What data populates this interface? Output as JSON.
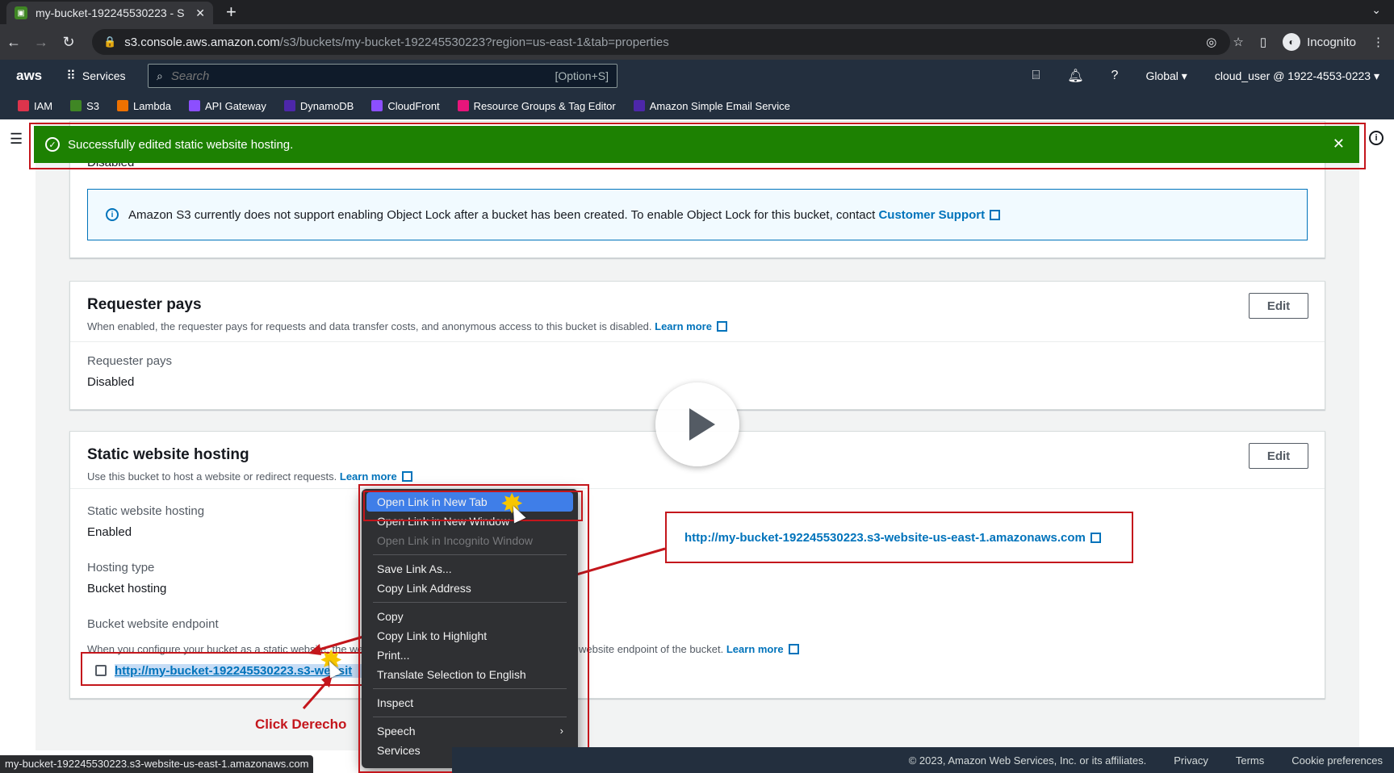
{
  "browser": {
    "tab_title": "my-bucket-192245530223 - S",
    "url_host": "s3.console.aws.amazon.com",
    "url_path": "/s3/buckets/my-bucket-192245530223?region=us-east-1&tab=properties",
    "profile_label": "Incognito"
  },
  "aws_header": {
    "logo": "aws",
    "services_label": "Services",
    "search_placeholder": "Search",
    "search_hint": "[Option+S]",
    "region": "Global",
    "account": "cloud_user @ 1922-4553-0223"
  },
  "favorites": [
    {
      "label": "IAM",
      "color": "#dd344c"
    },
    {
      "label": "S3",
      "color": "#3f8624"
    },
    {
      "label": "Lambda",
      "color": "#ed7100"
    },
    {
      "label": "API Gateway",
      "color": "#8c4fff"
    },
    {
      "label": "DynamoDB",
      "color": "#4d27aa"
    },
    {
      "label": "CloudFront",
      "color": "#8c4fff"
    },
    {
      "label": "Resource Groups & Tag Editor",
      "color": "#e7157b"
    },
    {
      "label": "Amazon Simple Email Service",
      "color": "#4d27aa"
    }
  ],
  "flash": {
    "message": "Successfully edited static website hosting."
  },
  "object_lock": {
    "value": "Disabled",
    "info": "Amazon S3 currently does not support enabling Object Lock after a bucket has been created. To enable Object Lock for this bucket, contact ",
    "link": "Customer Support"
  },
  "requester_pays": {
    "title": "Requester pays",
    "description": "When enabled, the requester pays for requests and data transfer costs, and anonymous access to this bucket is disabled. ",
    "learn_more": "Learn more",
    "edit": "Edit",
    "label": "Requester pays",
    "value": "Disabled"
  },
  "static_hosting": {
    "title": "Static website hosting",
    "description": "Use this bucket to host a website or redirect requests. ",
    "learn_more": "Learn more",
    "edit": "Edit",
    "hosting_label": "Static website hosting",
    "hosting_value": "Enabled",
    "type_label": "Hosting type",
    "type_value": "Bucket hosting",
    "endpoint_label": "Bucket website endpoint",
    "endpoint_desc_start": "When you configure your bucket as a static website, the we",
    "endpoint_desc_end": "website endpoint of the bucket. ",
    "endpoint_learn_more": "Learn more",
    "endpoint_url": "http://my-bucket-192245530223.s3-website-us-east-1.amazonaws.com",
    "endpoint_visible": "http://my-bucket-192245530223.s3-websit"
  },
  "context_menu": {
    "items": [
      "Open Link in New Tab",
      "Open Link in New Window",
      "Open Link in Incognito Window",
      "Save Link As...",
      "Copy Link Address",
      "Copy",
      "Copy Link to Highlight",
      "Print...",
      "Translate Selection to English",
      "Inspect",
      "Speech",
      "Services"
    ]
  },
  "annotation": {
    "label": "Click Derecho"
  },
  "status_bar": "my-bucket-192245530223.s3-website-us-east-1.amazonaws.com",
  "footer": {
    "copyright": "© 2023, Amazon Web Services, Inc. or its affiliates.",
    "privacy": "Privacy",
    "terms": "Terms",
    "cookies": "Cookie preferences"
  }
}
